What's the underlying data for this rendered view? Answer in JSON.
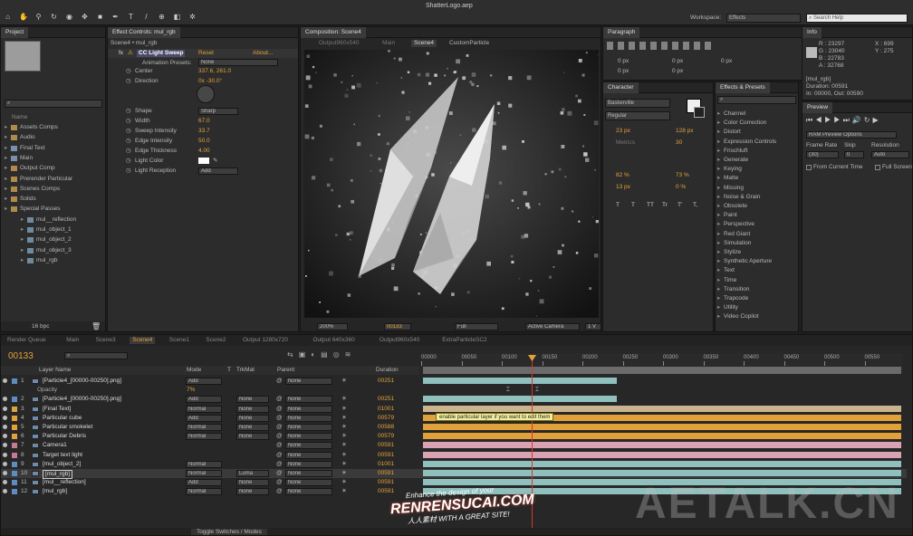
{
  "window_title": "ShatterLogo.aep",
  "toolbar": {
    "workspace_label": "Workspace:",
    "workspace_value": "Effects",
    "search_placeholder": "Search Help",
    "tools": [
      "home-icon",
      "hand-icon",
      "zoom-icon",
      "rotate-icon",
      "camera-icon",
      "pan-icon",
      "rect-icon",
      "pen-icon",
      "type-icon",
      "brush-icon",
      "clone-icon",
      "eraser-icon",
      "puppet-icon"
    ]
  },
  "project": {
    "tab": "Project",
    "items": [
      {
        "label": "Assets Comps",
        "type": "folder"
      },
      {
        "label": "Audio",
        "type": "folder"
      },
      {
        "label": "Final Text",
        "type": "comp"
      },
      {
        "label": "Main",
        "type": "comp"
      },
      {
        "label": "Output Comp",
        "type": "folder"
      },
      {
        "label": "Prerender Particular",
        "type": "folder"
      },
      {
        "label": "Scenes Comps",
        "type": "folder"
      },
      {
        "label": "Solids",
        "type": "folder"
      },
      {
        "label": "Special Passes",
        "type": "folder"
      },
      {
        "label": "mul__reflection",
        "type": "footage"
      },
      {
        "label": "mul_object_1",
        "type": "footage"
      },
      {
        "label": "mul_object_2",
        "type": "footage"
      },
      {
        "label": "mul_object_3",
        "type": "footage"
      },
      {
        "label": "mul_rgb",
        "type": "footage"
      }
    ],
    "bpc": "16 bpc"
  },
  "effect_controls": {
    "tab": "Effect Controls: mul_rgb",
    "breadcrumb": "Scene4 • mul_rgb",
    "effect_name": "CC Light Sweep",
    "reset": "Reset",
    "about": "About...",
    "anim_presets_label": "Animation Presets:",
    "anim_presets_value": "None",
    "params": [
      {
        "label": "Center",
        "value": "337.6, 261.0"
      },
      {
        "label": "Direction",
        "value": "0x -30.0°"
      },
      {
        "label": "Shape",
        "value": "Sharp"
      },
      {
        "label": "Width",
        "value": "67.0"
      },
      {
        "label": "Sweep Intensity",
        "value": "33.7"
      },
      {
        "label": "Edge Intensity",
        "value": "50.0"
      },
      {
        "label": "Edge Thickness",
        "value": "4.00"
      },
      {
        "label": "Light Color",
        "value": ""
      },
      {
        "label": "Light Reception",
        "value": "Add"
      }
    ]
  },
  "composition": {
    "tab": "Composition: Scene4",
    "subtabs": [
      "Output960x540",
      "Main",
      "Scene4",
      "CustomParticle"
    ],
    "zoom": "200%",
    "timecode": "00133",
    "resolution": "Full",
    "camera": "Active Camera",
    "view": "1 V"
  },
  "paragraph": {
    "tab": "Paragraph",
    "fields": [
      "0 px",
      "0 px",
      "0 px",
      "0 px",
      "0 px"
    ]
  },
  "character": {
    "tab": "Character",
    "font": "Baskerville",
    "style": "Regular",
    "size": "23 px",
    "leading": "128 px",
    "kerning": "Metrics",
    "tracking": "30",
    "vscale": "82 %",
    "hscale": "73 %",
    "baseline": "13 px",
    "tsume": "0 %",
    "styles": [
      "T",
      "T",
      "TT",
      "Tr",
      "T'",
      "T,"
    ]
  },
  "effects_presets": {
    "tab": "Effects & Presets",
    "categories": [
      "Channel",
      "Color Correction",
      "Distort",
      "Expression Controls",
      "Frischluft",
      "Generate",
      "Keying",
      "Matte",
      "Missing",
      "Noise & Grain",
      "Obsolete",
      "Paint",
      "Perspective",
      "Red Giant",
      "Simulation",
      "Stylize",
      "Synthetic Aperture",
      "Text",
      "Time",
      "Transition",
      "Trapcode",
      "Utility",
      "Video Copilot"
    ]
  },
  "info": {
    "tab": "Info",
    "r": "R : 23297",
    "g": "G : 23040",
    "b": "B : 22783",
    "a": "A : 32768",
    "x": "X : 699",
    "y": "Y : 275",
    "layer": "[mul_rgb]",
    "duration": "Duration: 00591",
    "inout": "In: 00000, Out: 00590"
  },
  "preview": {
    "tab": "Preview",
    "ram_options": "RAM Preview Options",
    "frame_rate_label": "Frame Rate",
    "skip_label": "Skip",
    "resolution_label": "Resolution",
    "frame_rate": "(30)",
    "skip": "0",
    "resolution": "Auto",
    "from_current": "From Current Time",
    "full_screen": "Full Screen"
  },
  "timeline": {
    "tabs": [
      "Render Queue",
      "Main",
      "Scene3",
      "Scene4",
      "Scene1",
      "Scene2",
      "Output 1280x720",
      "Output 640x360",
      "Output960x540",
      "ExtraParticleSC2"
    ],
    "active_tab": "Scene4",
    "current_time": "00133",
    "columns": {
      "name": "Layer Name",
      "mode": "Mode",
      "t": "T",
      "trkmat": "TrkMat",
      "parent": "Parent",
      "duration": "Duration"
    },
    "ruler": [
      "00000",
      "00050",
      "00100",
      "00150",
      "00200",
      "00250",
      "00300",
      "00350",
      "00400",
      "00450",
      "00500",
      "00550"
    ],
    "tooltip": "enable particular layer if you want to edit them",
    "layers": [
      {
        "num": "1",
        "name": "[Particle4_[00000-00250].png]",
        "mode": "Add",
        "trkmat": "",
        "parent": "None",
        "duration": "00251",
        "color": "#8fc0bd",
        "label": "#5f8cc0",
        "start": 0.0,
        "end": 0.405
      },
      {
        "num": "",
        "name": "Opacity",
        "mode": "",
        "trkmat": "",
        "parent": "",
        "duration": "",
        "color": "",
        "label": "",
        "start": 0,
        "end": 0,
        "sub": true,
        "value": "7%"
      },
      {
        "num": "2",
        "name": "[Particle4_[00000-00250].png]",
        "mode": "Add",
        "trkmat": "None",
        "parent": "None",
        "duration": "00251",
        "color": "#8fc0bd",
        "label": "#5f8cc0",
        "start": 0.0,
        "end": 0.405
      },
      {
        "num": "3",
        "name": "[Final Text]",
        "mode": "Normal",
        "trkmat": "None",
        "parent": "None",
        "duration": "01001",
        "color": "#c9b48f",
        "label": "#d6a643",
        "start": 0.0,
        "end": 1.0
      },
      {
        "num": "4",
        "name": "Particular cube",
        "mode": "Add",
        "trkmat": "None",
        "parent": "None",
        "duration": "00579",
        "color": "#e0a03a",
        "label": "#e0a03a",
        "start": 0.0,
        "end": 1.0
      },
      {
        "num": "5",
        "name": "Particular smokelet",
        "mode": "Normal",
        "trkmat": "None",
        "parent": "None",
        "duration": "00588",
        "color": "#e0a03a",
        "label": "#e0a03a",
        "start": 0.0,
        "end": 1.0
      },
      {
        "num": "6",
        "name": "Particular Debris",
        "mode": "Normal",
        "trkmat": "None",
        "parent": "None",
        "duration": "00579",
        "color": "#e0a03a",
        "label": "#e0a03a",
        "start": 0.0,
        "end": 1.0
      },
      {
        "num": "7",
        "name": "Camera1",
        "mode": "",
        "trkmat": "",
        "parent": "None",
        "duration": "00591",
        "color": "#d9a3b4",
        "label": "#c47a92",
        "start": 0.0,
        "end": 1.0
      },
      {
        "num": "8",
        "name": "Target text light",
        "mode": "",
        "trkmat": "",
        "parent": "None",
        "duration": "00591",
        "color": "#d9a3b4",
        "label": "#c47a92",
        "start": 0.0,
        "end": 1.0
      },
      {
        "num": "9",
        "name": "[mul_object_2]",
        "mode": "Normal",
        "trkmat": "",
        "parent": "None",
        "duration": "01001",
        "color": "#8fc0bd",
        "label": "#5f8cc0",
        "start": 0.0,
        "end": 1.0
      },
      {
        "num": "10",
        "name": "[mul_rgb]",
        "mode": "Normal",
        "trkmat": "Luma",
        "parent": "None",
        "duration": "00591",
        "color": "#8fc0bd",
        "label": "#5f8cc0",
        "start": 0.0,
        "end": 1.0,
        "selected": true
      },
      {
        "num": "11",
        "name": "[mul__reflection]",
        "mode": "Add",
        "trkmat": "None",
        "parent": "None",
        "duration": "00591",
        "color": "#8fc0bd",
        "label": "#5f8cc0",
        "start": 0.0,
        "end": 1.0
      },
      {
        "num": "12",
        "name": "[mul_rgb]",
        "mode": "Normal",
        "trkmat": "None",
        "parent": "None",
        "duration": "00591",
        "color": "#8fc0bd",
        "label": "#5f8cc0",
        "start": 0.0,
        "end": 1.0
      }
    ],
    "toggle": "Toggle Switches / Modes"
  },
  "watermarks": {
    "renren_line1": "Enhance the design of your",
    "renren_main": "RENRENSUCAI.COM",
    "renren_line2": "人人素材 WITH A GREAT SITE!",
    "aetalk": "AETALK.CN"
  }
}
